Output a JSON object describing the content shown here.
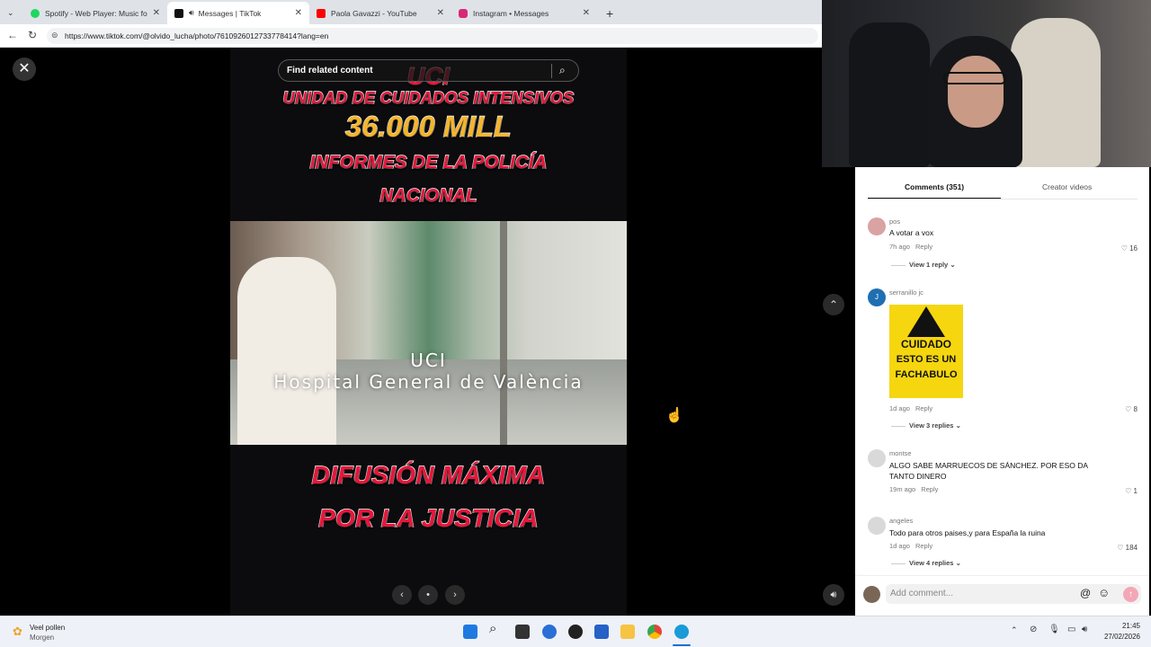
{
  "browser": {
    "tabs": [
      {
        "title": "Spotify - Web Player: Music for ev",
        "color": "#1ed760"
      },
      {
        "title": "Messages | TikTok",
        "color": "#111111"
      },
      {
        "title": "Paola Gavazzi - YouTube",
        "color": "#ff0000"
      },
      {
        "title": "Instagram • Messages",
        "color": "#d62976"
      }
    ],
    "url": "https://www.tiktok.com/@olvido_lucha/photo/7610926012733778414?lang=en"
  },
  "post": {
    "search_placeholder": "Find related content",
    "headline_1": "UCI",
    "headline_2": "UNIDAD DE CUIDADOS INTENSIVOS",
    "headline_3": "36.000 MILL",
    "headline_4": "INFORMES DE LA POLICÍA",
    "headline_5": "NACIONAL",
    "photo_line_1": "UCI",
    "photo_line_2": "Hospital General de València",
    "footer_1": "DIFUSIÓN MÁXIMA",
    "footer_2": "POR LA JUSTICIA"
  },
  "comments_panel": {
    "tab_comments": "Comments (351)",
    "tab_creator": "Creator videos",
    "comments": [
      {
        "user": "pos",
        "text": "A votar a vox",
        "time": "7h ago",
        "reply": "Reply",
        "likes": "16",
        "view": "View 1 reply"
      },
      {
        "user": "serranillo jc",
        "text": "",
        "time": "1d ago",
        "reply": "Reply",
        "likes": "8",
        "view": "View 3 replies",
        "sticker_1": "CUIDADO",
        "sticker_2": "ESTO ES UN",
        "sticker_3": "FACHABULO"
      },
      {
        "user": "montse",
        "text": "ALGO SABE MARRUECOS DE SÁNCHEZ. POR ESO DA TANTO DINERO",
        "time": "19m ago",
        "reply": "Reply",
        "likes": "1"
      },
      {
        "user": "angeles",
        "text": "Todo para otros paises,y para España la ruina",
        "time": "1d ago",
        "reply": "Reply",
        "likes": "184",
        "view": "View 4 replies"
      }
    ],
    "input_placeholder": "Add comment..."
  },
  "taskbar": {
    "weather_title": "Veel pollen",
    "weather_sub": "Morgen",
    "time": "21:45",
    "date": "27/02/2026"
  }
}
